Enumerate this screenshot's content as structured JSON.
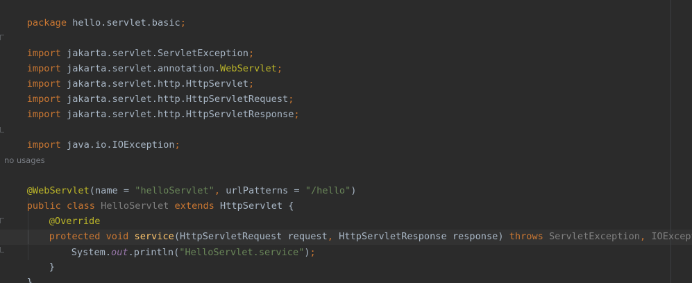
{
  "editor": {
    "lines": {
      "l1": {
        "kw": "package",
        "name": " hello.servlet.basic",
        "semi": ";"
      },
      "l3": {
        "kw": "import",
        "name": " jakarta.servlet.ServletException",
        "semi": ";"
      },
      "l4": {
        "kw": "import",
        "name": " jakarta.servlet.annotation.",
        "ann": "WebServlet",
        "semi": ";"
      },
      "l5": {
        "kw": "import",
        "name": " jakarta.servlet.http.HttpServlet",
        "semi": ";"
      },
      "l6": {
        "kw": "import",
        "name": " jakarta.servlet.http.HttpServletRequest",
        "semi": ";"
      },
      "l7": {
        "kw": "import",
        "name": " jakarta.servlet.http.HttpServletResponse",
        "semi": ";"
      },
      "l9": {
        "kw": "import",
        "name": " java.io.IOException",
        "semi": ";"
      },
      "hint": "no usages",
      "l11": {
        "ann": "@WebServlet",
        "p1": "(name = ",
        "s1": "\"helloServlet\"",
        "comma": ",",
        "p2": " urlPatterns = ",
        "s2": "\"/hello\"",
        "p3": ")"
      },
      "l12": {
        "kw1": "public class",
        "cls": " HelloServlet",
        "kw2": " extends",
        "base": " HttpServlet {"
      },
      "l13": {
        "ann": "@Override"
      },
      "l14": {
        "kw1": "protected void",
        "fn": " service",
        "p1": "(HttpServletRequest request",
        "comma1": ",",
        "p2": " HttpServletResponse response) ",
        "kw2": "throws",
        "e1": " ServletException",
        "comma2": ",",
        "e2": " IOException",
        "p3": " {"
      },
      "l15": {
        "p1": "System.",
        "out": "out",
        "p2": ".println(",
        "s": "\"HelloServlet.service\"",
        "p3": ")",
        "semi": ";"
      },
      "l16": {
        "p": "}"
      },
      "l17": {
        "p": "}"
      }
    }
  }
}
